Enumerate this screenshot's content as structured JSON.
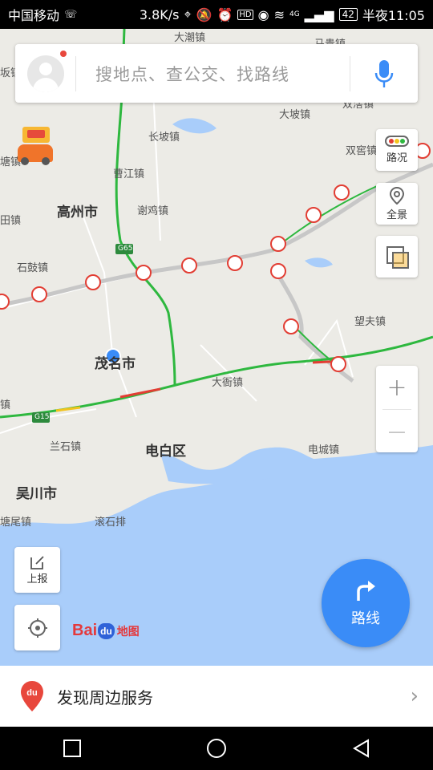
{
  "status_bar": {
    "carrier": "中国移动",
    "speed": "3.8K/s",
    "network": "4G",
    "battery": "42",
    "time": "半夜11:05"
  },
  "search": {
    "placeholder": "搜地点、查公交、找路线"
  },
  "side_buttons": {
    "traffic": "路况",
    "panorama": "全景"
  },
  "zoom": {
    "plus": "+",
    "minus": "—"
  },
  "left_buttons": {
    "report": "上报"
  },
  "route_button": {
    "label": "路线"
  },
  "logo": {
    "bai": "Bai",
    "du": "du",
    "map": "地图"
  },
  "bottom_panel": {
    "label": "发现周边服务"
  },
  "highways": {
    "g65": "G65",
    "g15": "G15"
  },
  "places": {
    "dachao": "大潮镇",
    "mamao": "马贵镇",
    "ban": "坂镇",
    "shuanghuo": "双滘镇",
    "dapo": "大坡镇",
    "changpo": "长坡镇",
    "tang": "塘镇",
    "shuangjiao": "双窖镇",
    "caojiang": "曹江镇",
    "gaozhou": "高州市",
    "xieji": "谢鸡镇",
    "tian": "田镇",
    "shigu": "石鼓镇",
    "wangfu": "望夫镇",
    "maoming": "茂名市",
    "dayan": "大衙镇",
    "zhen": "镇",
    "lanshi": "兰石镇",
    "dianbai": "电白区",
    "diancheng": "电城镇",
    "wuchuan": "吴川市",
    "tangwei": "塘尾镇",
    "bingshipai": "滚石排"
  }
}
